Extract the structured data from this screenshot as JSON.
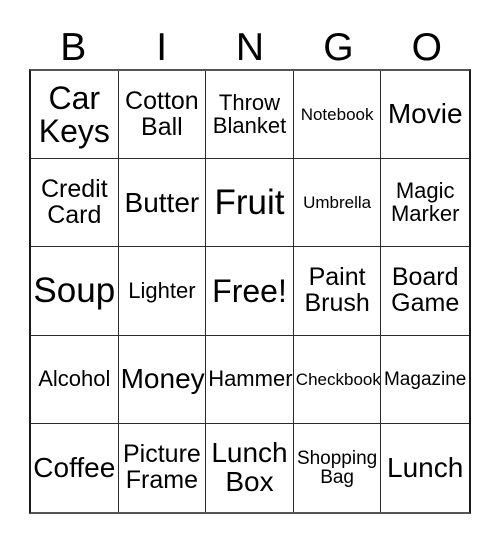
{
  "card": {
    "title_letters": [
      "B",
      "I",
      "N",
      "G",
      "O"
    ],
    "columns": 5,
    "rows": 5,
    "free_space_label": "Free!",
    "border_color": "#1a1a1a",
    "background_color": "#ffffff",
    "text_color": "#000000"
  },
  "grid": {
    "rows": [
      {
        "cells": [
          {
            "text": "Car\nKeys",
            "size": "xl"
          },
          {
            "text": "Cotton\nBall",
            "size": "m"
          },
          {
            "text": "Throw\nBlanket",
            "size": "s"
          },
          {
            "text": "Notebook",
            "size": "xxs"
          },
          {
            "text": "Movie",
            "size": "l"
          }
        ]
      },
      {
        "cells": [
          {
            "text": "Credit\nCard",
            "size": "m"
          },
          {
            "text": "Butter",
            "size": "l"
          },
          {
            "text": "Fruit",
            "size": "xxl"
          },
          {
            "text": "Umbrella",
            "size": "xxs"
          },
          {
            "text": "Magic\nMarker",
            "size": "s"
          }
        ]
      },
      {
        "cells": [
          {
            "text": "Soup",
            "size": "xxl"
          },
          {
            "text": "Lighter",
            "size": "s"
          },
          {
            "text": "Free!",
            "size": "xl"
          },
          {
            "text": "Paint\nBrush",
            "size": "m"
          },
          {
            "text": "Board\nGame",
            "size": "m"
          }
        ]
      },
      {
        "cells": [
          {
            "text": "Alcohol",
            "size": "s"
          },
          {
            "text": "Money",
            "size": "l"
          },
          {
            "text": "Hammer",
            "size": "s"
          },
          {
            "text": "Checkbook",
            "size": "xxs"
          },
          {
            "text": "Magazine",
            "size": "xs"
          }
        ]
      },
      {
        "cells": [
          {
            "text": "Coffee",
            "size": "l"
          },
          {
            "text": "Picture\nFrame",
            "size": "m"
          },
          {
            "text": "Lunch\nBox",
            "size": "l"
          },
          {
            "text": "Shopping\nBag",
            "size": "xs"
          },
          {
            "text": "Lunch",
            "size": "l"
          }
        ]
      }
    ]
  }
}
